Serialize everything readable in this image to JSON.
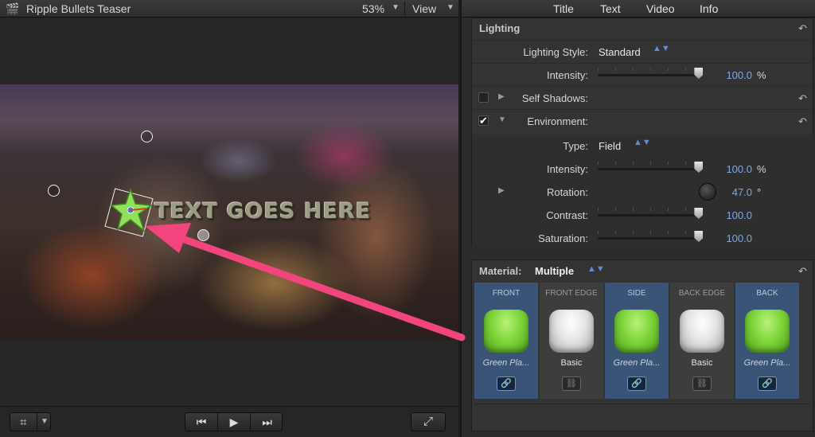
{
  "viewer": {
    "title": "Ripple Bullets Teaser",
    "zoom": "53%",
    "view_label": "View",
    "canvas_text": "TEXT GOES HERE",
    "icons": {
      "clip": "clapperboard-icon",
      "dropdown": "triangle-down",
      "crop": "crop-icon",
      "prev": "skip-back",
      "play": "play",
      "next": "skip-forward",
      "fullscreen": "expand"
    },
    "glyphs": {
      "clip": "🎬",
      "dropdown": "▼",
      "crop": "⌗",
      "prev": "⏮",
      "play": "▶",
      "next": "⏭",
      "fullscreen": "⤢"
    }
  },
  "inspector": {
    "tabs": [
      "Title",
      "Text",
      "Video",
      "Info"
    ],
    "lighting": {
      "title": "Lighting",
      "reset_glyph": "↶",
      "style_label": "Lighting Style:",
      "style_value": "Standard",
      "intensity_label": "Intensity:",
      "intensity_value": "100.0",
      "intensity_unit": "%",
      "self_shadows_label": "Self Shadows:",
      "environment_label": "Environment:",
      "environment_checked": "✔",
      "type_label": "Type:",
      "type_value": "Field",
      "env_intensity_label": "Intensity:",
      "env_intensity_value": "100.0",
      "env_intensity_unit": "%",
      "rotation_label": "Rotation:",
      "rotation_value": "47.0",
      "rotation_unit": "°",
      "contrast_label": "Contrast:",
      "contrast_value": "100.0",
      "saturation_label": "Saturation:",
      "saturation_value": "100.0",
      "stepper_glyph": "▲▼",
      "disclosure_closed": "▶",
      "disclosure_open": "▼"
    },
    "material": {
      "title": "Material:",
      "value": "Multiple",
      "faces": [
        {
          "label": "FRONT",
          "name": "Green Pla...",
          "color": "green",
          "selected": true,
          "link": "🔗"
        },
        {
          "label": "FRONT EDGE",
          "name": "Basic",
          "color": "white",
          "selected": false,
          "link": "⛓"
        },
        {
          "label": "SIDE",
          "name": "Green Pla...",
          "color": "green",
          "selected": true,
          "link": "🔗"
        },
        {
          "label": "BACK EDGE",
          "name": "Basic",
          "color": "white",
          "selected": false,
          "link": "⛓"
        },
        {
          "label": "BACK",
          "name": "Green Pla...",
          "color": "green",
          "selected": true,
          "link": "🔗"
        }
      ]
    }
  },
  "colors": {
    "accent_blue": "#7fa8e0",
    "selected_face": "#3a5478",
    "arrow": "#f2457e"
  },
  "slider_levels": {
    "intensity": 0.98,
    "env_intensity": 0.98,
    "contrast": 0.98,
    "saturation": 0.98
  }
}
